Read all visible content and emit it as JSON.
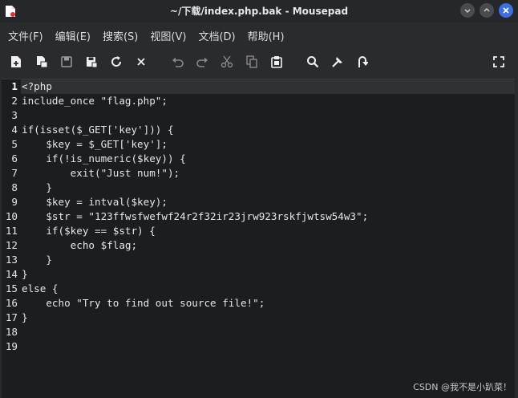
{
  "window": {
    "title": "~/下载/index.php.bak - Mousepad"
  },
  "menu": [
    {
      "label": "文件(F)"
    },
    {
      "label": "编辑(E)"
    },
    {
      "label": "搜索(S)"
    },
    {
      "label": "视图(V)"
    },
    {
      "label": "文档(D)"
    },
    {
      "label": "帮助(H)"
    }
  ],
  "toolbar": {
    "icons": [
      "new-document-icon",
      "new-window-icon",
      "save-icon",
      "save-as-icon",
      "reload-icon",
      "close-tab-icon",
      "undo-icon",
      "redo-icon",
      "cut-icon",
      "copy-icon",
      "paste-icon",
      "find-icon",
      "replace-icon",
      "goto-line-icon",
      "fullscreen-icon"
    ]
  },
  "editor": {
    "current_line": 1,
    "lines": [
      {
        "num": "1",
        "text": "<?php"
      },
      {
        "num": "2",
        "text": "include_once \"flag.php\";"
      },
      {
        "num": "3",
        "text": ""
      },
      {
        "num": "4",
        "text": "if(isset($_GET['key'])) {"
      },
      {
        "num": "5",
        "text": "    $key = $_GET['key'];"
      },
      {
        "num": "6",
        "text": "    if(!is_numeric($key)) {"
      },
      {
        "num": "7",
        "text": "        exit(\"Just num!\");"
      },
      {
        "num": "8",
        "text": "    }"
      },
      {
        "num": "9",
        "text": "    $key = intval($key);"
      },
      {
        "num": "10",
        "text": "    $str = \"123ffwsfwefwf24r2f32ir23jrw923rskfjwtsw54w3\";"
      },
      {
        "num": "11",
        "text": "    if($key == $str) {"
      },
      {
        "num": "12",
        "text": "        echo $flag;"
      },
      {
        "num": "13",
        "text": "    }"
      },
      {
        "num": "14",
        "text": "}"
      },
      {
        "num": "15",
        "text": "else {"
      },
      {
        "num": "16",
        "text": "    echo \"Try to find out source file!\";"
      },
      {
        "num": "17",
        "text": "}"
      },
      {
        "num": "18",
        "text": ""
      },
      {
        "num": "19",
        "text": ""
      }
    ]
  },
  "watermark": "CSDN @我不是小趴菜！"
}
